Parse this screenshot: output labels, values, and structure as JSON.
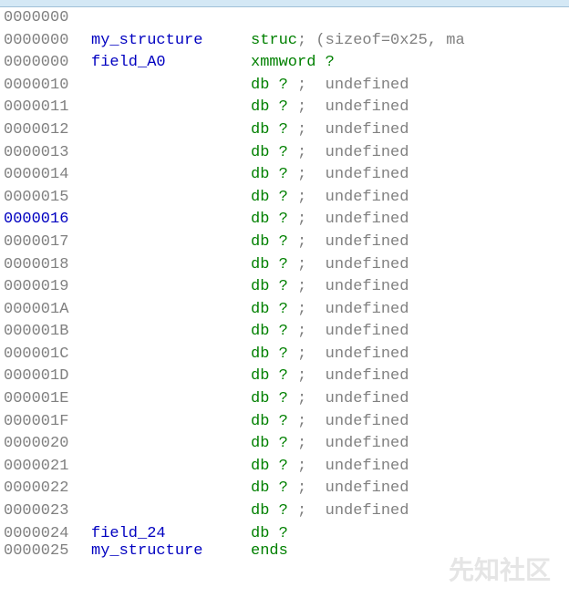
{
  "lines": [
    {
      "offset": "0000000",
      "field": "",
      "kw": "",
      "comment": "",
      "rest": ""
    },
    {
      "offset": "0000000",
      "field": "my_structure",
      "kw": "struc",
      "comment": "; (sizeof=0x25, ma",
      "rest": ""
    },
    {
      "offset": "0000000",
      "field": "field_A0",
      "kw": "xmmword",
      "comment": "",
      "rest": "?"
    },
    {
      "offset": "0000010",
      "field": "",
      "kw": "db",
      "comment": ";  undefined",
      "rest": "? "
    },
    {
      "offset": "0000011",
      "field": "",
      "kw": "db",
      "comment": ";  undefined",
      "rest": "? "
    },
    {
      "offset": "0000012",
      "field": "",
      "kw": "db",
      "comment": ";  undefined",
      "rest": "? "
    },
    {
      "offset": "0000013",
      "field": "",
      "kw": "db",
      "comment": ";  undefined",
      "rest": "? "
    },
    {
      "offset": "0000014",
      "field": "",
      "kw": "db",
      "comment": ";  undefined",
      "rest": "? "
    },
    {
      "offset": "0000015",
      "field": "",
      "kw": "db",
      "comment": ";  undefined",
      "rest": "? "
    },
    {
      "offset": "0000016",
      "field": "",
      "kw": "db",
      "comment": ";  undefined",
      "rest": "? ",
      "sel": true
    },
    {
      "offset": "0000017",
      "field": "",
      "kw": "db",
      "comment": ";  undefined",
      "rest": "? "
    },
    {
      "offset": "0000018",
      "field": "",
      "kw": "db",
      "comment": ";  undefined",
      "rest": "? "
    },
    {
      "offset": "0000019",
      "field": "",
      "kw": "db",
      "comment": ";  undefined",
      "rest": "? "
    },
    {
      "offset": "000001A",
      "field": "",
      "kw": "db",
      "comment": ";  undefined",
      "rest": "? "
    },
    {
      "offset": "000001B",
      "field": "",
      "kw": "db",
      "comment": ";  undefined",
      "rest": "? "
    },
    {
      "offset": "000001C",
      "field": "",
      "kw": "db",
      "comment": ";  undefined",
      "rest": "? "
    },
    {
      "offset": "000001D",
      "field": "",
      "kw": "db",
      "comment": ";  undefined",
      "rest": "? "
    },
    {
      "offset": "000001E",
      "field": "",
      "kw": "db",
      "comment": ";  undefined",
      "rest": "? "
    },
    {
      "offset": "000001F",
      "field": "",
      "kw": "db",
      "comment": ";  undefined",
      "rest": "? "
    },
    {
      "offset": "0000020",
      "field": "",
      "kw": "db",
      "comment": ";  undefined",
      "rest": "? "
    },
    {
      "offset": "0000021",
      "field": "",
      "kw": "db",
      "comment": ";  undefined",
      "rest": "? "
    },
    {
      "offset": "0000022",
      "field": "",
      "kw": "db",
      "comment": ";  undefined",
      "rest": "? "
    },
    {
      "offset": "0000023",
      "field": "",
      "kw": "db",
      "comment": ";  undefined",
      "rest": "? "
    },
    {
      "offset": "0000024",
      "field": "field_24",
      "kw": "db",
      "comment": "",
      "rest": "?"
    },
    {
      "offset": "0000025",
      "field": "my_structure",
      "kw": "ends",
      "comment": "",
      "rest": "",
      "cut": true
    }
  ],
  "watermark": "先知社区"
}
